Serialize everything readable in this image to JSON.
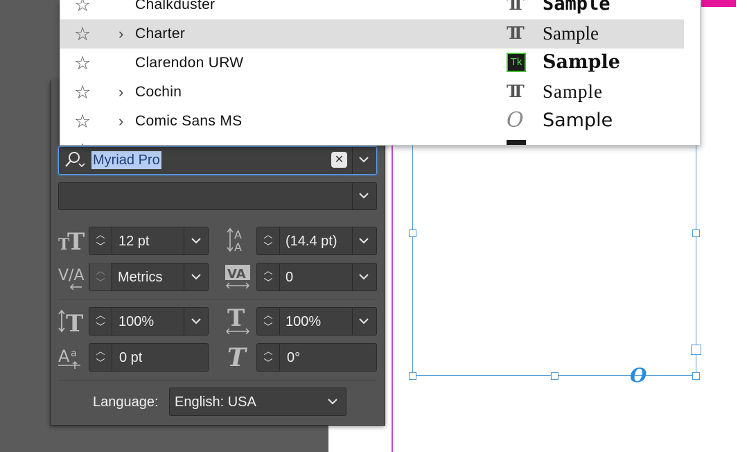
{
  "font_list": {
    "rows": [
      {
        "name": "Chalkduster",
        "sample": "Sample",
        "type_icon": "truetype-icon",
        "expandable": false,
        "selected": false
      },
      {
        "name": "Charter",
        "sample": "Sample",
        "type_icon": "truetype-icon",
        "expandable": true,
        "selected": true
      },
      {
        "name": "Clarendon URW",
        "sample": "Sample",
        "type_icon": "typekit-icon",
        "expandable": false,
        "selected": false
      },
      {
        "name": "Cochin",
        "sample": "Sample",
        "type_icon": "truetype-icon",
        "expandable": true,
        "selected": false
      },
      {
        "name": "Comic Sans MS",
        "sample": "Sample",
        "type_icon": "opentype-icon",
        "expandable": true,
        "selected": false
      }
    ],
    "typekit_label": "Tk",
    "opentype_label": "O"
  },
  "font_search": {
    "value": "Myriad Pro",
    "clear_icon": "close-icon",
    "dropdown_icon": "chevron-down-icon"
  },
  "font_style": {
    "value": ""
  },
  "font_size": {
    "value": "12 pt",
    "icon": "font-size-icon"
  },
  "leading": {
    "value": "(14.4 pt)",
    "icon": "leading-icon"
  },
  "kerning": {
    "value": "Metrics",
    "icon": "kerning-icon"
  },
  "tracking": {
    "value": "0",
    "icon": "tracking-icon"
  },
  "vertical_scale": {
    "value": "100%",
    "icon": "vertical-scale-icon"
  },
  "horizontal_scale": {
    "value": "100%",
    "icon": "horizontal-scale-icon"
  },
  "baseline_shift": {
    "value": "0 pt",
    "icon": "baseline-shift-icon"
  },
  "skew": {
    "value": "0°",
    "icon": "skew-icon"
  },
  "language": {
    "label": "Language:",
    "value": "English: USA"
  },
  "colors": {
    "panel": "#535353",
    "field": "#3f3f3f",
    "focus": "#5b9df0",
    "frame": "#4d9bd6",
    "guide": "#c14ec8",
    "accent_pink": "#e5149a",
    "typekit_green": "#47c72e"
  }
}
